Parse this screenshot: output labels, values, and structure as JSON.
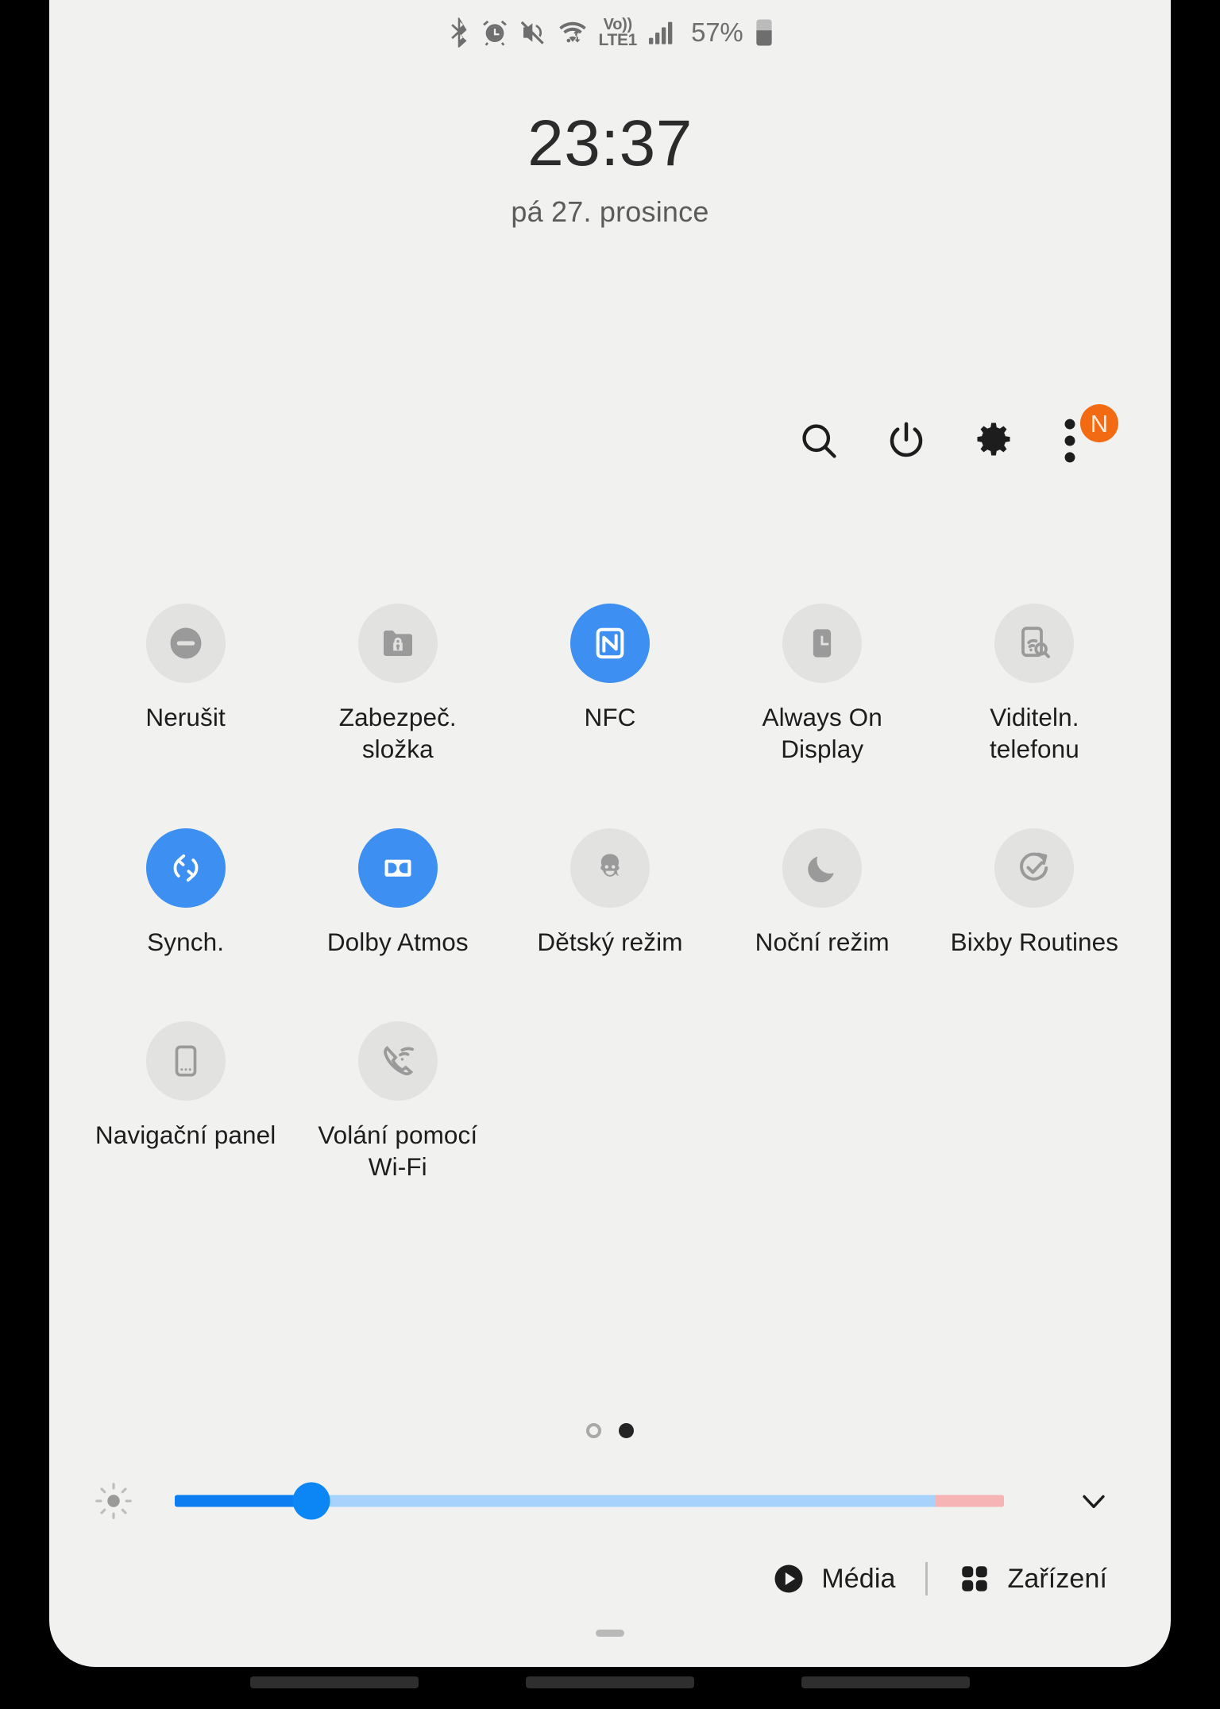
{
  "status_bar": {
    "icons": [
      "bluetooth-icon",
      "alarm-icon",
      "mute-icon",
      "wifi-icon",
      "volte-icon",
      "signal-icon"
    ],
    "volte_label_top": "Vo))",
    "volte_label_bottom": "LTE1",
    "battery_percent": "57%"
  },
  "clock": {
    "time": "23:37",
    "date": "pá 27. prosince"
  },
  "actions": [
    {
      "name": "search-icon",
      "label": "Hledat"
    },
    {
      "name": "power-icon",
      "label": "Vypnout"
    },
    {
      "name": "gear-icon",
      "label": "Nastavení"
    },
    {
      "name": "overflow-menu-icon",
      "label": "Další",
      "badge": "N"
    }
  ],
  "tiles": [
    {
      "label": "Nerušit",
      "icon": "do-not-disturb-icon",
      "active": false
    },
    {
      "label": "Zabezpeč. složka",
      "icon": "secure-folder-icon",
      "active": false
    },
    {
      "label": "NFC",
      "icon": "nfc-icon",
      "active": true
    },
    {
      "label": "Always On Display",
      "icon": "always-on-display-icon",
      "active": false
    },
    {
      "label": "Viditeln. telefonu",
      "icon": "phone-visibility-icon",
      "active": false
    },
    {
      "label": "Synch.",
      "icon": "sync-icon",
      "active": true
    },
    {
      "label": "Dolby Atmos",
      "icon": "dolby-atmos-icon",
      "active": true
    },
    {
      "label": "Dětský režim",
      "icon": "kids-mode-icon",
      "active": false
    },
    {
      "label": "Noční režim",
      "icon": "night-mode-icon",
      "active": false
    },
    {
      "label": "Bixby Routines",
      "icon": "bixby-routines-icon",
      "active": false
    },
    {
      "label": "Navigační panel",
      "icon": "navigation-bar-icon",
      "active": false
    },
    {
      "label": "Volání pomocí Wi-Fi",
      "icon": "wifi-calling-icon",
      "active": false
    }
  ],
  "pager": {
    "pages": 2,
    "current": 2
  },
  "brightness": {
    "icon": "brightness-icon",
    "value_percent": 17,
    "expand_icon": "chevron-down-icon"
  },
  "bottom_bar": {
    "media_label": "Média",
    "media_icon": "play-circle-icon",
    "devices_label": "Zařízení",
    "devices_icon": "grid-four-dots-icon"
  },
  "colors": {
    "panel_bg": "#f1f1f0",
    "tile_off_bg": "#e2e2e1",
    "tile_on_bg": "#3d8ff2",
    "accent_blue": "#0c86f5",
    "badge_orange": "#f26a11",
    "warn_pink": "#f7b4b4"
  }
}
